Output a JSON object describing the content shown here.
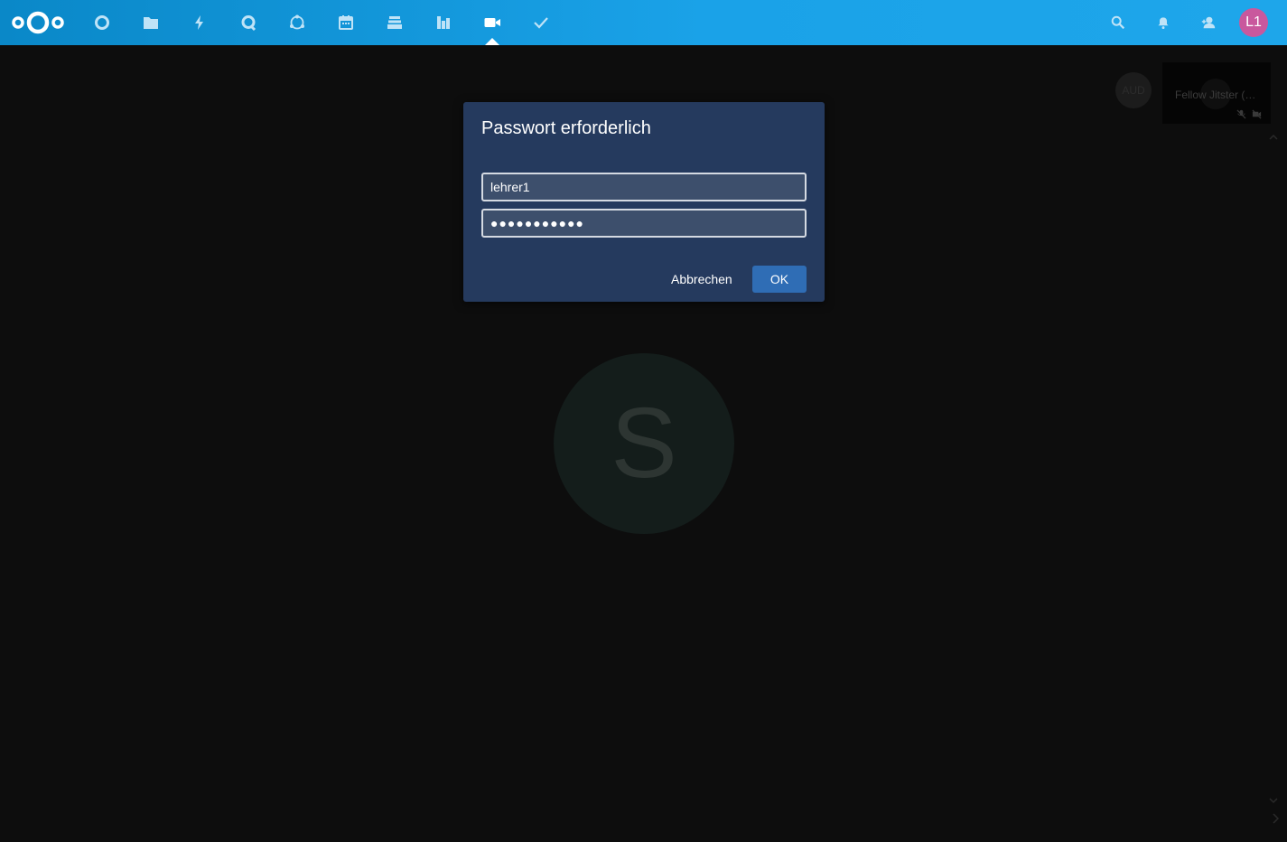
{
  "header": {
    "avatar_initials": "L1",
    "colors": {
      "bar_start": "#0a88c8",
      "bar_end": "#1ea6ea",
      "avatar_bg": "#c9589d"
    },
    "nav_icons": [
      "dashboard-icon",
      "files-icon",
      "activity-icon",
      "talk-icon",
      "circles-icon",
      "calendar-icon",
      "deck-icon",
      "analytics-icon",
      "video-icon",
      "tasks-icon"
    ],
    "active_app": "video-icon",
    "right_icons": [
      "search-icon",
      "notifications-icon",
      "contacts-icon"
    ]
  },
  "conference": {
    "large_avatar_letter": "S",
    "small_avatar_text": "AUD",
    "thumbnail_name": "Fellow Jitster (…",
    "thumbnail_icons": [
      "mic-muted-icon",
      "camera-off-icon"
    ]
  },
  "dialog": {
    "title": "Passwort erforderlich",
    "username_value": "lehrer1",
    "password_value": "●●●●●●●●●●●",
    "cancel_label": "Abbrechen",
    "ok_label": "OK",
    "colors": {
      "background": "#253a5e",
      "ok_button": "#2f6db5"
    }
  }
}
